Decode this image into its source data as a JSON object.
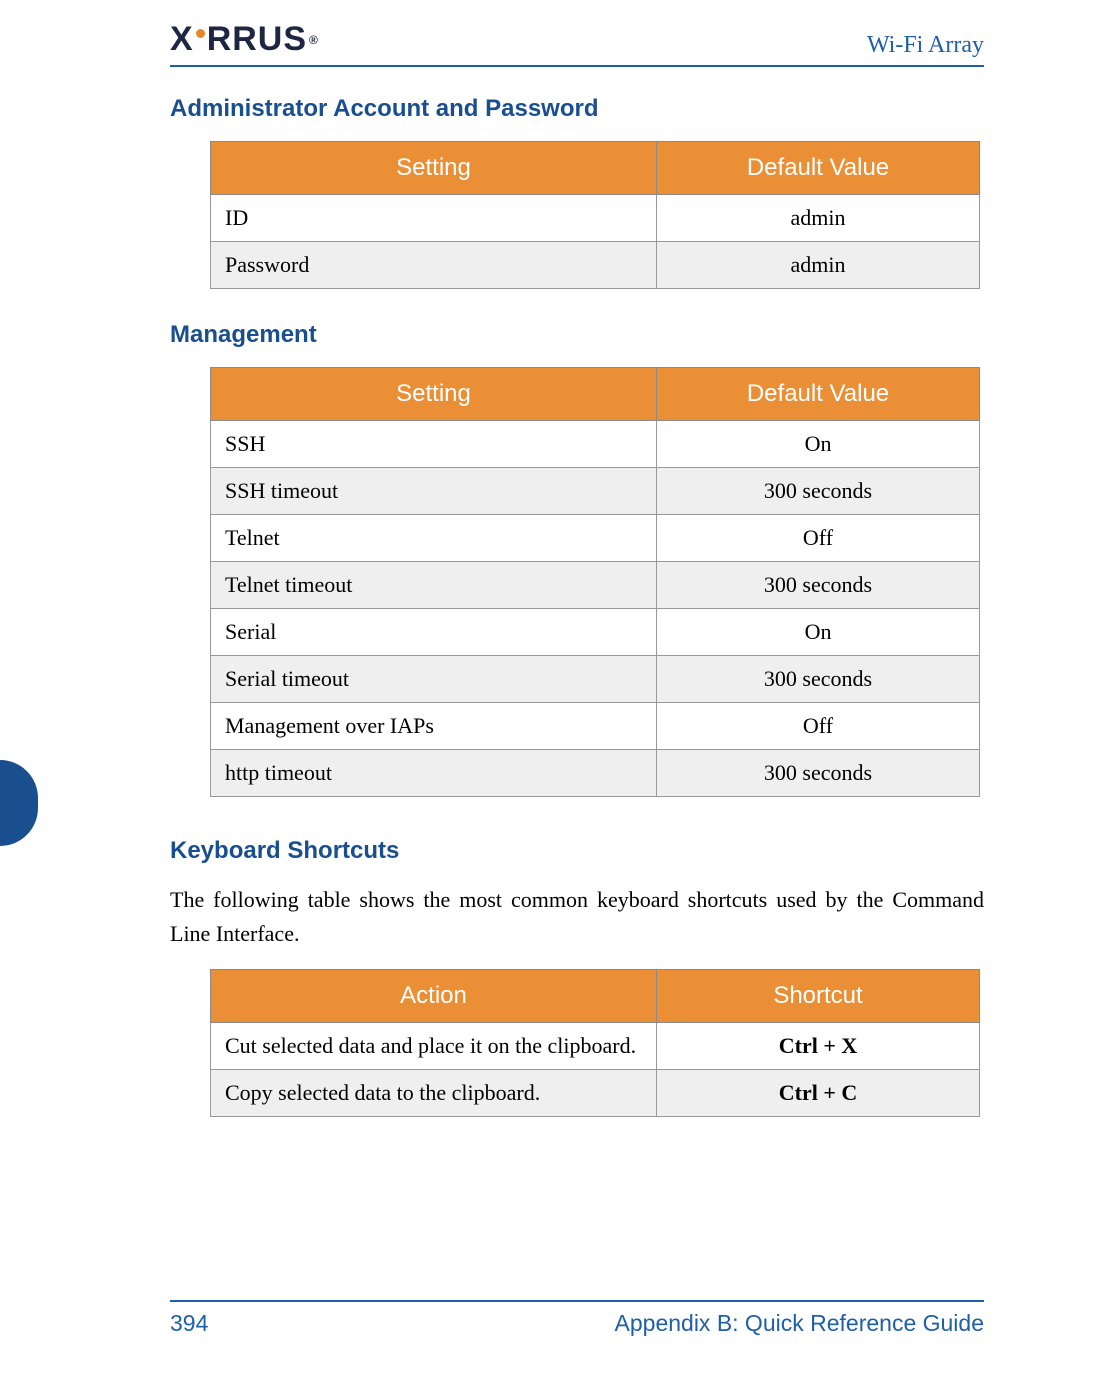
{
  "header": {
    "logo_left": "X",
    "logo_right": "RRUS",
    "product": "Wi-Fi Array"
  },
  "sections": {
    "admin": {
      "heading": "Administrator Account and Password",
      "columns": [
        "Setting",
        "Default Value"
      ],
      "rows": [
        {
          "setting": "ID",
          "value": "admin"
        },
        {
          "setting": "Password",
          "value": "admin"
        }
      ]
    },
    "management": {
      "heading": "Management",
      "columns": [
        "Setting",
        "Default Value"
      ],
      "rows": [
        {
          "setting": "SSH",
          "value": "On"
        },
        {
          "setting": "SSH timeout",
          "value": "300 seconds"
        },
        {
          "setting": "Telnet",
          "value": "Off"
        },
        {
          "setting": "Telnet timeout",
          "value": "300 seconds"
        },
        {
          "setting": "Serial",
          "value": "On"
        },
        {
          "setting": "Serial timeout",
          "value": "300 seconds"
        },
        {
          "setting": "Management over IAPs",
          "value": "Off"
        },
        {
          "setting": "http timeout",
          "value": "300 seconds"
        }
      ]
    },
    "shortcuts": {
      "heading": "Keyboard Shortcuts",
      "intro": "The following table shows the most common keyboard shortcuts used by the Command Line Interface.",
      "columns": [
        "Action",
        "Shortcut"
      ],
      "rows": [
        {
          "action": "Cut selected data and place it on the clipboard.",
          "shortcut": "Ctrl + X"
        },
        {
          "action": "Copy selected data to the clipboard.",
          "shortcut": "Ctrl + C"
        }
      ]
    }
  },
  "footer": {
    "page": "394",
    "title": "Appendix B: Quick Reference Guide"
  }
}
